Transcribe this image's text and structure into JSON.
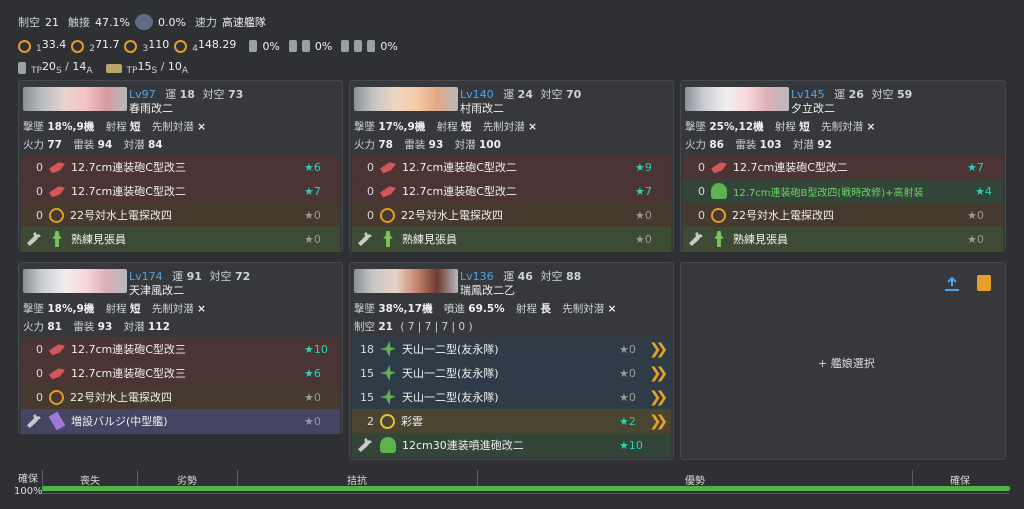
{
  "fleet": {
    "seiku_label": "制空",
    "seiku_value": "21",
    "shoku_label": "触接",
    "shoku_value": "47.1%",
    "plane_value": "0.0%",
    "speed_label": "速力",
    "speed_value": "高速艦隊",
    "los1": "1",
    "los1_val": "33.4",
    "los2": "2",
    "los2_val": "71.7",
    "los3": "3",
    "los3_val": "110",
    "los4": "4",
    "los4_val": "148.29",
    "drum1": "0%",
    "drum2": "0%",
    "drum3": "0%",
    "tp_label": "TP",
    "tp_s": "20",
    "s1": "S",
    "tp_a": "14",
    "a1": "A",
    "tp2_label": "TP",
    "tp2_s": "15",
    "s2": "S",
    "tp2_a": "10",
    "a2": "A",
    "slash": "/"
  },
  "ships": [
    {
      "lv": "Lv97",
      "luck_label": "運",
      "luck": "18",
      "aa_label": "対空",
      "aa": "73",
      "name": "春雨改二",
      "line1": {
        "evasion_label": "撃墜",
        "evasion": "18%,9機",
        "range_label": "射程",
        "range": "短",
        "oasw_label": "先制対潜",
        "oasw": "×"
      },
      "line2": {
        "fp_label": "火力",
        "fp": "77",
        "torp_label": "雷装",
        "torp": "94",
        "asw_label": "対潜",
        "asw": "84"
      },
      "slots": [
        {
          "count": "0",
          "name": "12.7cm連装砲C型改三",
          "star": "★6"
        },
        {
          "count": "0",
          "name": "12.7cm連装砲C型改二",
          "star": "★7"
        },
        {
          "count": "0",
          "name": "22号対水上電探改四",
          "star": "★0"
        },
        {
          "count": "",
          "name": "熟練見張員",
          "star": "★0"
        }
      ]
    },
    {
      "lv": "Lv140",
      "luck_label": "運",
      "luck": "24",
      "aa_label": "対空",
      "aa": "70",
      "name": "村雨改二",
      "line1": {
        "evasion_label": "撃墜",
        "evasion": "17%,9機",
        "range_label": "射程",
        "range": "短",
        "oasw_label": "先制対潜",
        "oasw": "×"
      },
      "line2": {
        "fp_label": "火力",
        "fp": "78",
        "torp_label": "雷装",
        "torp": "93",
        "asw_label": "対潜",
        "asw": "100"
      },
      "slots": [
        {
          "count": "0",
          "name": "12.7cm連装砲C型改二",
          "star": "★9"
        },
        {
          "count": "0",
          "name": "12.7cm連装砲C型改二",
          "star": "★7"
        },
        {
          "count": "0",
          "name": "22号対水上電探改四",
          "star": "★0"
        },
        {
          "count": "",
          "name": "熟練見張員",
          "star": "★0"
        }
      ]
    },
    {
      "lv": "Lv145",
      "luck_label": "運",
      "luck": "26",
      "aa_label": "対空",
      "aa": "59",
      "name": "夕立改二",
      "line1": {
        "evasion_label": "撃墜",
        "evasion": "25%,12機",
        "range_label": "射程",
        "range": "短",
        "oasw_label": "先制対潜",
        "oasw": "×"
      },
      "line2": {
        "fp_label": "火力",
        "fp": "86",
        "torp_label": "雷装",
        "torp": "103",
        "asw_label": "対潜",
        "asw": "92"
      },
      "slots": [
        {
          "count": "0",
          "name": "12.7cm連装砲C型改二",
          "star": "★7"
        },
        {
          "count": "0",
          "name": "12.7cm連装砲B型改四(戦時改修)+高射装",
          "star": "★4"
        },
        {
          "count": "0",
          "name": "22号対水上電探改四",
          "star": "★0"
        },
        {
          "count": "",
          "name": "熟練見張員",
          "star": "★0"
        }
      ]
    },
    {
      "lv": "Lv174",
      "luck_label": "運",
      "luck": "91",
      "aa_label": "対空",
      "aa": "72",
      "name": "天津風改二",
      "line1": {
        "evasion_label": "撃墜",
        "evasion": "18%,9機",
        "range_label": "射程",
        "range": "短",
        "oasw_label": "先制対潜",
        "oasw": "×"
      },
      "line2": {
        "fp_label": "火力",
        "fp": "81",
        "torp_label": "雷装",
        "torp": "93",
        "asw_label": "対潜",
        "asw": "112"
      },
      "slots": [
        {
          "count": "0",
          "name": "12.7cm連装砲C型改三",
          "star": "★10"
        },
        {
          "count": "0",
          "name": "12.7cm連装砲C型改三",
          "star": "★6"
        },
        {
          "count": "0",
          "name": "22号対水上電探改四",
          "star": "★0"
        },
        {
          "count": "",
          "name": "増設バルジ(中型艦)",
          "star": "★0"
        }
      ]
    },
    {
      "lv": "Lv136",
      "luck_label": "運",
      "luck": "46",
      "aa_label": "対空",
      "aa": "88",
      "name": "瑞鳳改二乙",
      "line1": {
        "evasion_label": "撃墜",
        "evasion": "38%,17機",
        "jet_label": "噴進",
        "jet": "69.5%",
        "range_label": "射程",
        "range": "長",
        "oasw_label": "先制対潜",
        "oasw": "×"
      },
      "line2": {
        "seiku_label": "制空",
        "seiku": "21",
        "detail": "( 7 | 7 | 7 | 0 )"
      },
      "slots": [
        {
          "count": "18",
          "name": "天山一二型(友永隊)",
          "star": "★0"
        },
        {
          "count": "15",
          "name": "天山一二型(友永隊)",
          "star": "★0"
        },
        {
          "count": "15",
          "name": "天山一二型(友永隊)",
          "star": "★0"
        },
        {
          "count": "2",
          "name": "彩雲",
          "star": "★2"
        },
        {
          "count": "",
          "name": "12cm30連装噴進砲改二",
          "star": "★10"
        }
      ]
    }
  ],
  "empty_slot": {
    "label": "+ 艦娘選択"
  },
  "bar": {
    "left_label": "確保",
    "percent": "100%",
    "lost": "喪失",
    "inferior": "劣勢",
    "parity": "拮抗",
    "superior": "優勢",
    "supremacy": "確保",
    "fill_fraction": 1.0
  },
  "colors": {
    "accent_blue": "#4ea3e8",
    "star_teal": "#2bd1b4",
    "bar_green": "#4fb54a"
  }
}
